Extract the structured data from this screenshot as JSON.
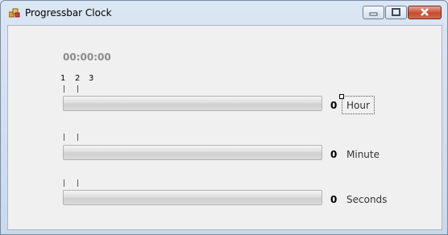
{
  "window": {
    "title": "Progressbar Clock"
  },
  "clock": {
    "time": "00:00:00"
  },
  "tick_labels": [
    "1",
    "2",
    "3"
  ],
  "bars": [
    {
      "value": "0",
      "label": "Hour",
      "progress": 0
    },
    {
      "value": "0",
      "label": "Minute",
      "progress": 0
    },
    {
      "value": "0",
      "label": "Seconds",
      "progress": 0
    }
  ]
}
